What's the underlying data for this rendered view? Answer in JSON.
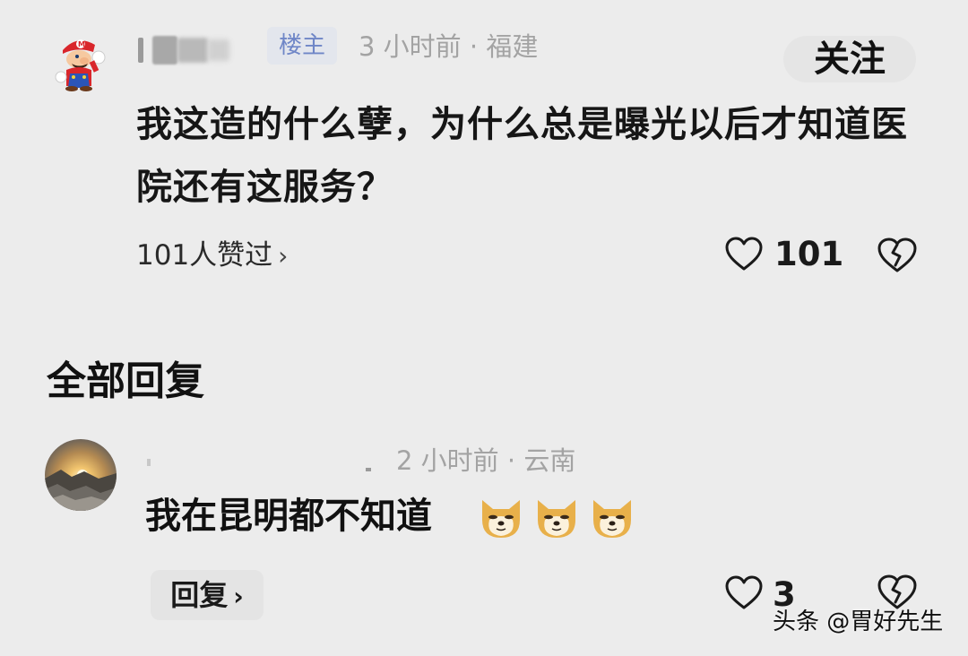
{
  "top_comment": {
    "badge": "楼主",
    "meta": "3 小时前 · 福建",
    "follow_label": "关注",
    "text": "我这造的什么孽，为什么总是曝光以后才知道医院还有这服务？",
    "likers_label": "101人赞过",
    "like_count": "101",
    "avatar_icon": "mario-avatar-icon",
    "like_icon": "heart-outline-icon",
    "dislike_icon": "broken-heart-icon"
  },
  "replies_section": {
    "title": "全部回复"
  },
  "reply": {
    "meta": "2 小时前 · 云南",
    "text": "我在昆明都不知道",
    "emoji_icon": "doge-emoji-icon",
    "reply_label": "回复",
    "like_count": "3",
    "avatar_icon": "sunset-landscape-avatar-icon"
  },
  "watermark": {
    "text": "头条 @胃好先生"
  },
  "colors": {
    "background": "#ececec",
    "badge_bg": "#e3e6ed",
    "badge_text": "#6f86c7",
    "meta_text": "#a3a3a3"
  }
}
